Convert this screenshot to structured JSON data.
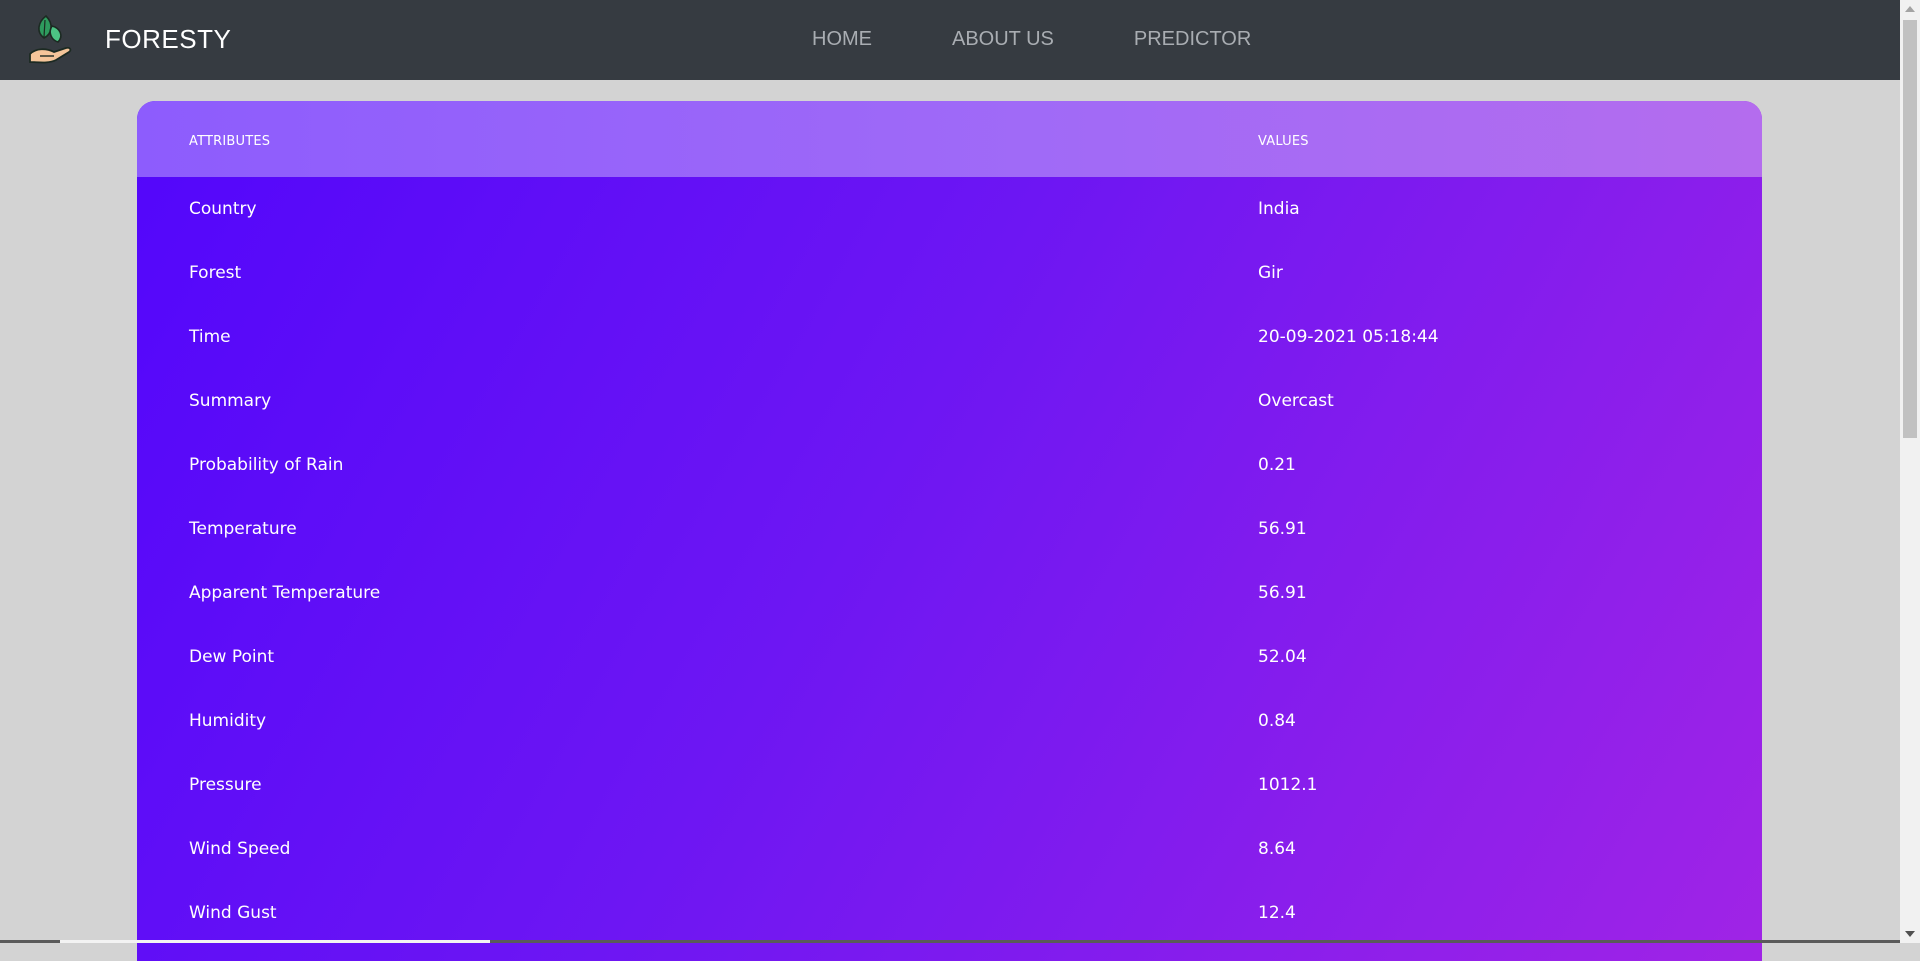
{
  "header": {
    "brand": "FORESTY",
    "nav": [
      {
        "label": "HOME"
      },
      {
        "label": "ABOUT US"
      },
      {
        "label": "PREDICTOR"
      }
    ]
  },
  "table": {
    "columns": [
      "ATTRIBUTES",
      "VALUES"
    ],
    "rows": [
      {
        "attribute": "Country",
        "value": "India"
      },
      {
        "attribute": "Forest",
        "value": "Gir"
      },
      {
        "attribute": "Time",
        "value": "20-09-2021 05:18:44"
      },
      {
        "attribute": "Summary",
        "value": "Overcast"
      },
      {
        "attribute": "Probability of Rain",
        "value": "0.21"
      },
      {
        "attribute": "Temperature",
        "value": "56.91"
      },
      {
        "attribute": "Apparent Temperature",
        "value": "56.91"
      },
      {
        "attribute": "Dew Point",
        "value": "52.04"
      },
      {
        "attribute": "Humidity",
        "value": "0.84"
      },
      {
        "attribute": "Pressure",
        "value": "1012.1"
      },
      {
        "attribute": "Wind Speed",
        "value": "8.64"
      },
      {
        "attribute": "Wind Gust",
        "value": "12.4"
      }
    ]
  },
  "icons": {
    "logo": "hand-holding-leaf-icon"
  },
  "colors": {
    "navbar": "#363b41",
    "page_background": "#d3d3d3",
    "table_gradient_start": "#5206fb",
    "table_gradient_end": "#a024e6",
    "header_gradient_start": "#8d5cfd",
    "header_gradient_end": "#b46cee"
  }
}
